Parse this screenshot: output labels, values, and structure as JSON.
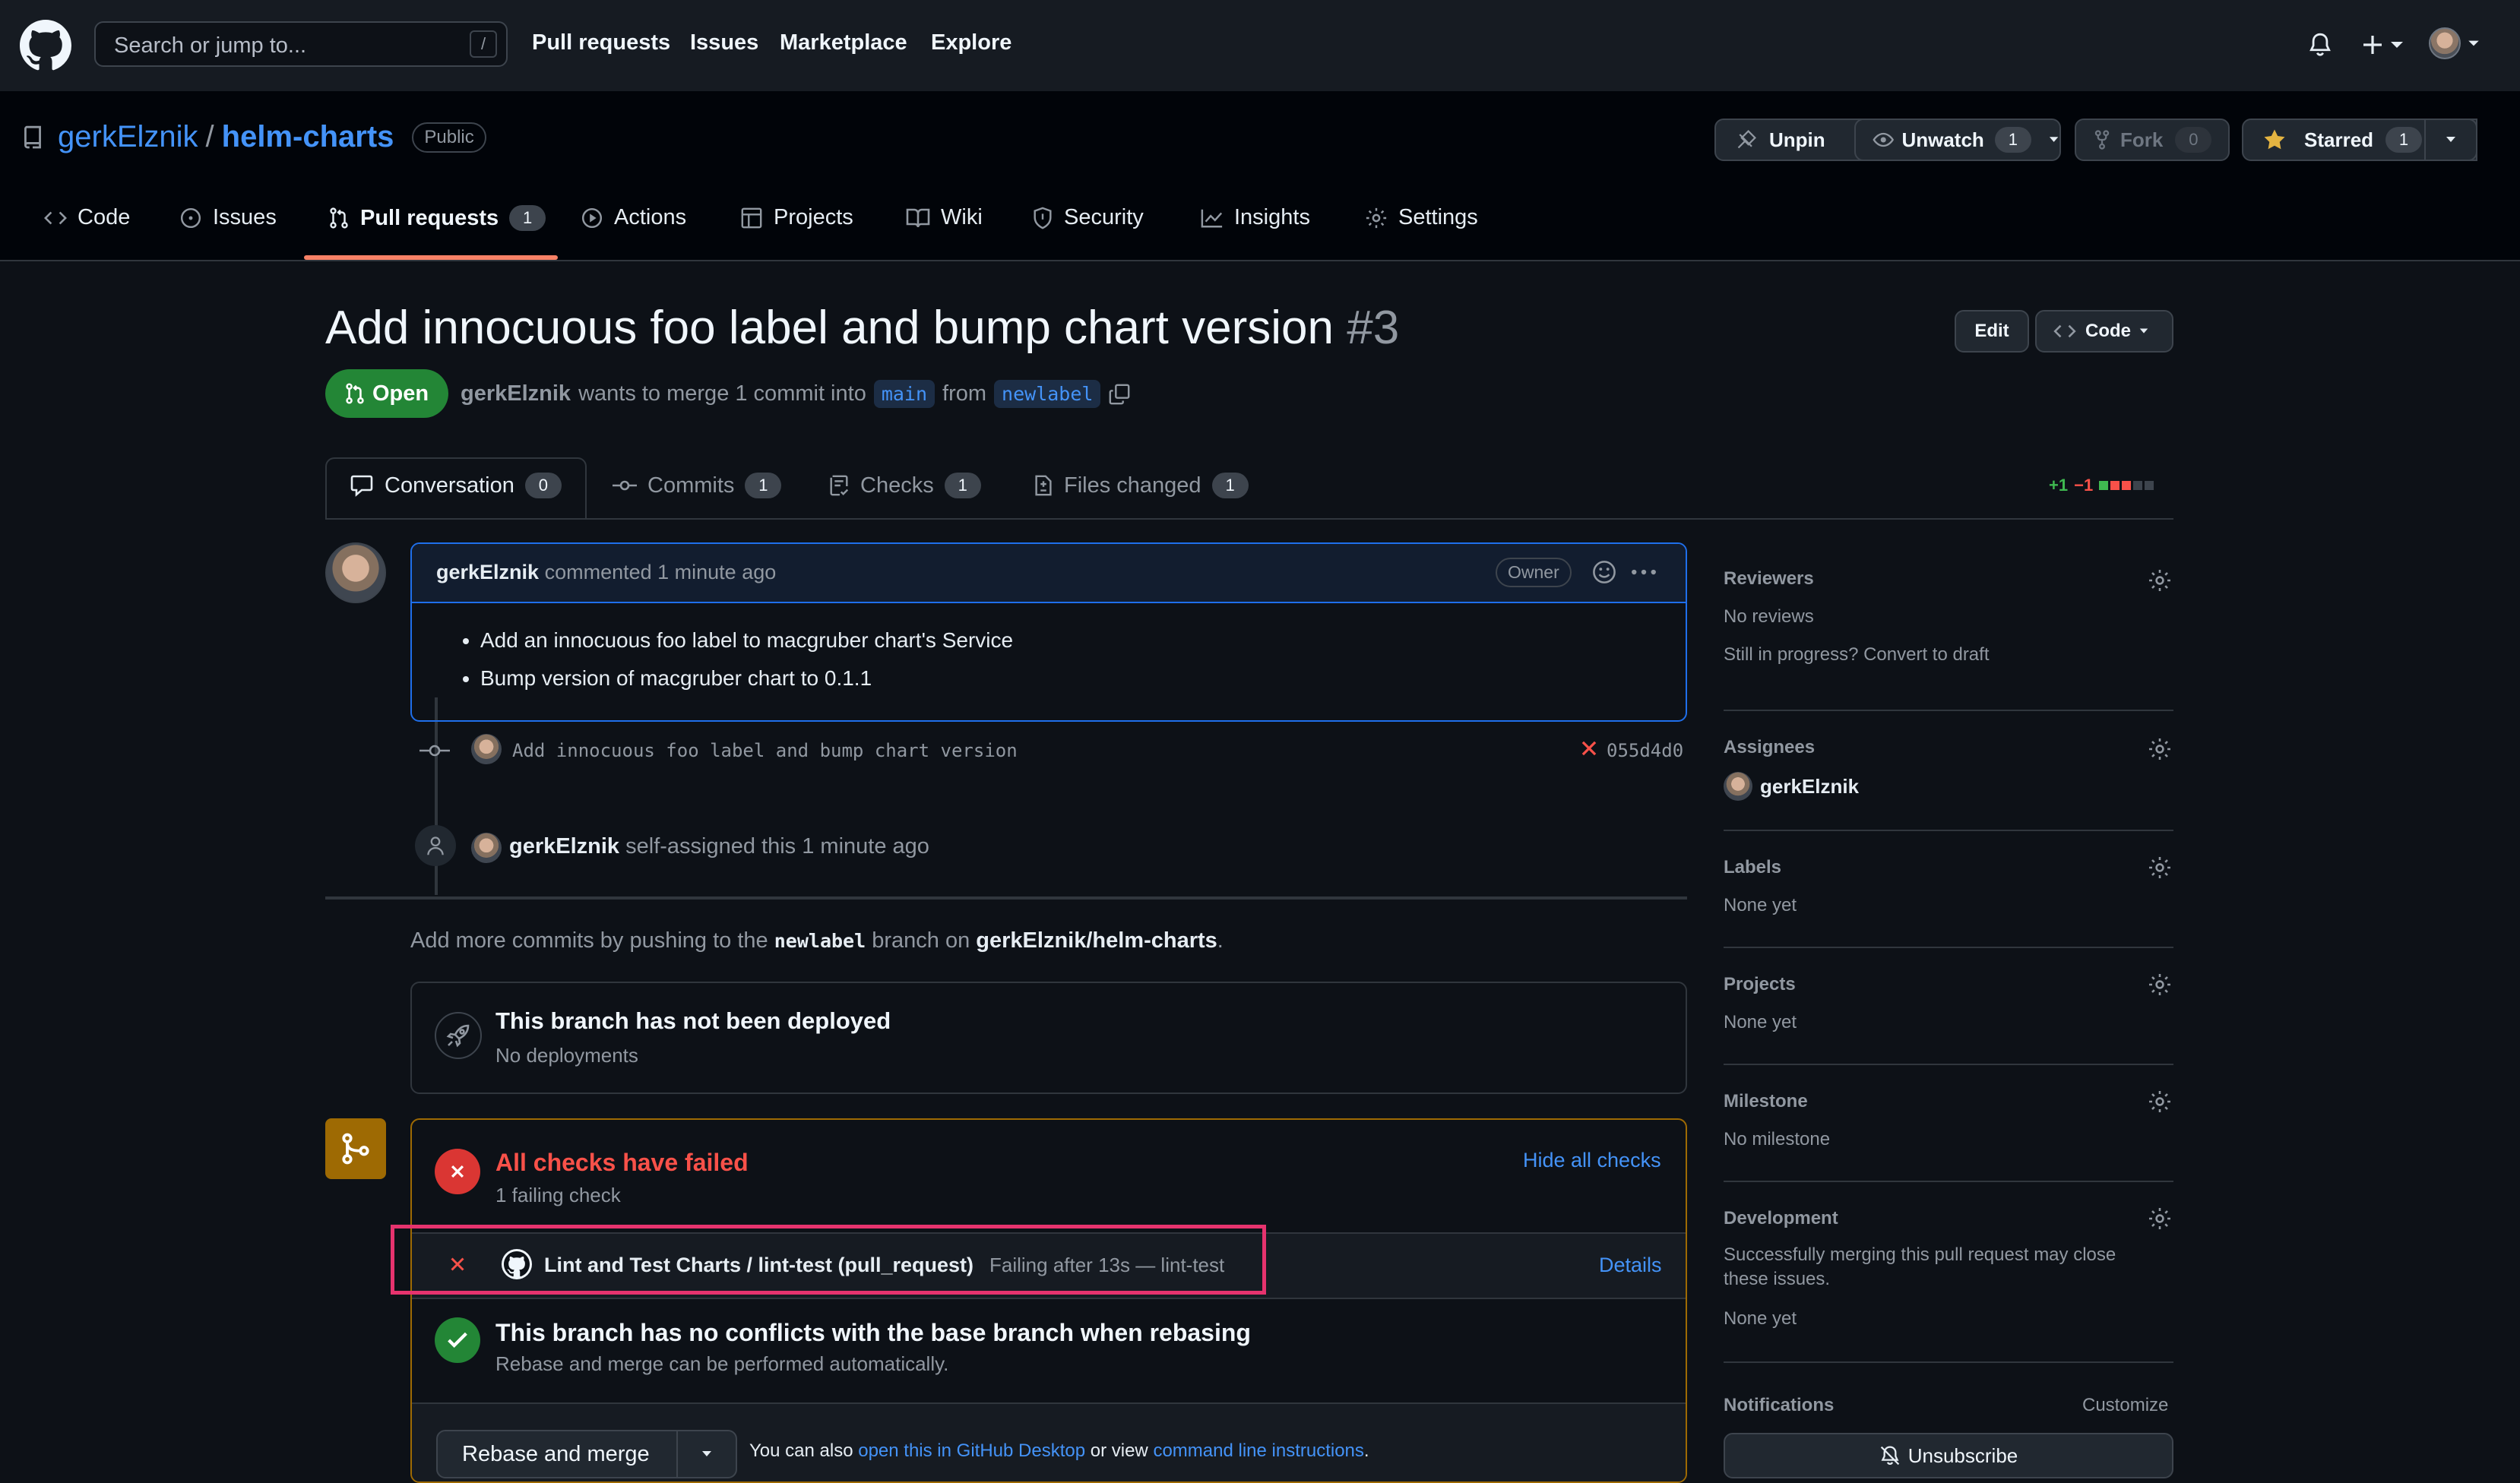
{
  "header": {
    "search_placeholder": "Search or jump to...",
    "search_shortcut": "/",
    "nav": [
      "Pull requests",
      "Issues",
      "Marketplace",
      "Explore"
    ]
  },
  "repo": {
    "owner": "gerkElznik",
    "separator": "/",
    "name": "helm-charts",
    "visibility": "Public",
    "unpin_label": "Unpin",
    "unwatch_label": "Unwatch",
    "watch_count": "1",
    "fork_label": "Fork",
    "fork_count": "0",
    "star_label": "Starred",
    "star_count": "1"
  },
  "repo_tabs": [
    {
      "label": "Code"
    },
    {
      "label": "Issues"
    },
    {
      "label": "Pull requests",
      "count": "1"
    },
    {
      "label": "Actions"
    },
    {
      "label": "Projects"
    },
    {
      "label": "Wiki"
    },
    {
      "label": "Security"
    },
    {
      "label": "Insights"
    },
    {
      "label": "Settings"
    }
  ],
  "pr": {
    "title": "Add innocuous foo label and bump chart version",
    "number": "#3",
    "edit_label": "Edit",
    "code_label": "Code",
    "state": "Open",
    "author": "gerkElznik",
    "merge_text": "wants to merge 1 commit into",
    "base": "main",
    "from_text": "from",
    "head": "newlabel",
    "diff_add": "+1",
    "diff_del": "−1"
  },
  "pr_tabs": [
    {
      "label": "Conversation",
      "count": "0"
    },
    {
      "label": "Commits",
      "count": "1"
    },
    {
      "label": "Checks",
      "count": "1"
    },
    {
      "label": "Files changed",
      "count": "1"
    }
  ],
  "comment": {
    "author": "gerkElznik",
    "meta": "commented 1 minute ago",
    "role": "Owner",
    "bullets": [
      "Add an innocuous foo label to macgruber chart's Service",
      "Bump version of macgruber chart to 0.1.1"
    ]
  },
  "commit": {
    "message": "Add innocuous foo label and bump chart version",
    "sha": "055d4d0"
  },
  "event": {
    "actor": "gerkElznik",
    "text": "self-assigned this 1 minute ago"
  },
  "push_hint": {
    "pre": "Add more commits by pushing to the",
    "branch": "newlabel",
    "mid": "branch on",
    "repo": "gerkElznik/helm-charts",
    "end": "."
  },
  "deploy": {
    "title": "This branch has not been deployed",
    "sub": "No deployments"
  },
  "checks": {
    "title": "All checks have failed",
    "sub": "1 failing check",
    "toggle": "Hide all checks",
    "row_name": "Lint and Test Charts / lint-test (pull_request)",
    "row_status": "Failing after 13s — lint-test",
    "details": "Details"
  },
  "conflicts": {
    "title": "This branch has no conflicts with the base branch when rebasing",
    "sub": "Rebase and merge can be performed automatically."
  },
  "merge": {
    "button": "Rebase and merge",
    "also": "You can also",
    "desktop_link": "open this in GitHub Desktop",
    "or_view": "or view",
    "cli_link": "command line instructions",
    "end": "."
  },
  "sidebar": {
    "reviewers": {
      "heading": "Reviewers",
      "value": "No reviews",
      "draft": "Still in progress? Convert to draft"
    },
    "assignees": {
      "heading": "Assignees",
      "value": "gerkElznik"
    },
    "labels": {
      "heading": "Labels",
      "value": "None yet"
    },
    "projects": {
      "heading": "Projects",
      "value": "None yet"
    },
    "milestone": {
      "heading": "Milestone",
      "value": "No milestone"
    },
    "development": {
      "heading": "Development",
      "desc1": "Successfully merging this pull request may close",
      "desc2": "these issues.",
      "value": "None yet"
    },
    "notifications": {
      "heading": "Notifications",
      "customize": "Customize",
      "unsubscribe": "Unsubscribe"
    }
  },
  "colors": {
    "bg": "#0d1117",
    "header": "#161b22",
    "open_green": "#238636",
    "fail_red": "#da3633",
    "accent_blue": "#4493f8",
    "highlight_pink": "#e6336e",
    "merge_yellow": "#9e6a03"
  }
}
